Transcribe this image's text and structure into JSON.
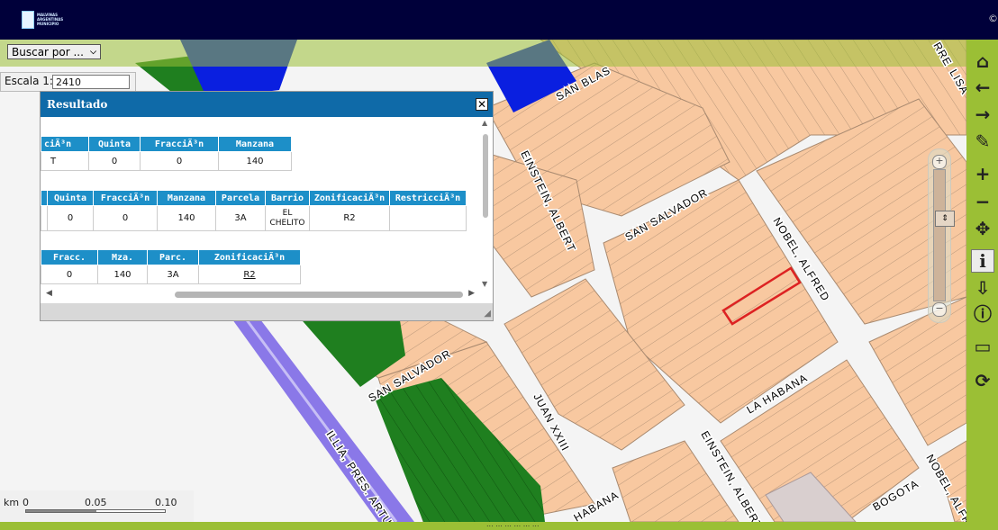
{
  "header": {
    "logo_text": "MALVINAS ARGENTINAS MUNICIPIO",
    "right_glyph": "©"
  },
  "search": {
    "selected": "Buscar por ...",
    "options": [
      "Buscar por ..."
    ]
  },
  "scale": {
    "label": "Escala 1:",
    "value": "2410"
  },
  "panel": {
    "title": "Resultado",
    "close_label": "✕",
    "table1": {
      "headers": [
        "ciÃ³n",
        "Quinta",
        "FracciÃ³n",
        "Manzana"
      ],
      "rows": [
        [
          "T",
          "0",
          "0",
          "140"
        ]
      ]
    },
    "table2": {
      "headers": [
        "",
        "Quinta",
        "FracciÃ³n",
        "Manzana",
        "Parcela",
        "Barrio",
        "ZonificaciÃ³n",
        "RestricciÃ³n"
      ],
      "rows": [
        [
          "",
          "0",
          "0",
          "140",
          "3A",
          "EL CHELITO",
          "R2",
          ""
        ]
      ]
    },
    "table3": {
      "headers": [
        "Fracc.",
        "Mza.",
        "Parc.",
        "ZonificaciÃ³n"
      ],
      "rows": [
        [
          "0",
          "140",
          "3A",
          "R2"
        ]
      ]
    }
  },
  "map": {
    "streets": [
      "SAN BLAS",
      "EINSTEIN, ALBERT",
      "SAN SALVADOR",
      "NOBEL, ALFRED",
      "SAN SALVADOR",
      "JUAN XXIII",
      "LA HABANA",
      "EINSTEIN, ALBERT",
      "ILLIA, PRES. ARTUR",
      "HABANA",
      "BOGOTA",
      "NOBEL, ALFRE",
      "LISA",
      "RRE"
    ],
    "colors": {
      "parcel": "#f8c8a0",
      "road": "#f2f2f2",
      "green": "#1f7f1f",
      "blue": "#0a1fe0",
      "purple": "#8a78e8",
      "highlight": "#dd2222",
      "accent": "#9bbf35"
    }
  },
  "scalebar": {
    "unit": "km",
    "ticks": [
      "0",
      "0.05",
      "0.10"
    ]
  },
  "toolbar": {
    "items": [
      {
        "name": "home-icon",
        "glyph": "⌂"
      },
      {
        "name": "arrow-left-icon",
        "glyph": "←"
      },
      {
        "name": "arrow-right-icon",
        "glyph": "→"
      },
      {
        "name": "measure-pencil-icon",
        "glyph": "✎"
      },
      {
        "name": "zoom-in-icon",
        "glyph": "+"
      },
      {
        "name": "zoom-out-icon",
        "glyph": "−"
      },
      {
        "name": "pan-icon",
        "glyph": "✥"
      },
      {
        "name": "info-icon",
        "glyph": "i"
      },
      {
        "name": "info-point-icon",
        "glyph": "⇩"
      },
      {
        "name": "info-circle-icon",
        "glyph": "ⓘ"
      },
      {
        "name": "ruler-icon",
        "glyph": "▭"
      },
      {
        "name": "refresh-icon",
        "glyph": "⟳"
      }
    ]
  },
  "footer_text": "... ... ... ... ... ..."
}
